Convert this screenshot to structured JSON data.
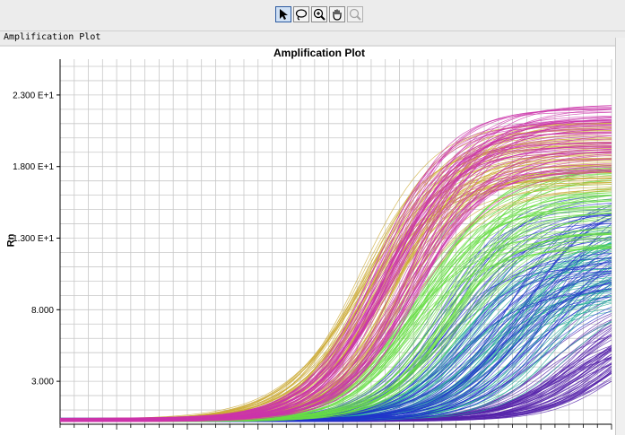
{
  "toolbar": {
    "tools": [
      "select-arrow-icon",
      "lasso-icon",
      "zoom-in-icon",
      "pan-hand-icon",
      "zoom-out-icon"
    ]
  },
  "panel": {
    "title": "Amplification Plot"
  },
  "chart_data": {
    "type": "line",
    "title": "Amplification Plot",
    "xlabel": "",
    "ylabel": "Rn",
    "ylim": [
      0,
      25.5
    ],
    "yticks": [
      3,
      8,
      13,
      18,
      23
    ],
    "ytick_labels": [
      "3.000",
      "8.000",
      "1.300 E+1",
      "1.800 E+1",
      "2.300 E+1"
    ],
    "xlim": [
      1,
      40
    ],
    "grid": true,
    "series_count": 384,
    "series_groups": [
      {
        "color": "#cc33aa",
        "plateau_range": [
          17,
          22
        ],
        "threshold_cycle_range": [
          21,
          25
        ]
      },
      {
        "color": "#ccaa33",
        "plateau_range": [
          16,
          21
        ],
        "threshold_cycle_range": [
          20,
          24
        ]
      },
      {
        "color": "#66dd44",
        "plateau_range": [
          12,
          18
        ],
        "threshold_cycle_range": [
          23,
          28
        ]
      },
      {
        "color": "#2233cc",
        "plateau_range": [
          9,
          16
        ],
        "threshold_cycle_range": [
          25,
          34
        ]
      },
      {
        "color": "#22aa99",
        "plateau_range": [
          8,
          14
        ],
        "threshold_cycle_range": [
          27,
          35
        ]
      },
      {
        "color": "#5522aa",
        "plateau_range": [
          5,
          10
        ],
        "threshold_cycle_range": [
          33,
          39
        ]
      }
    ],
    "baseline": 0.3
  }
}
